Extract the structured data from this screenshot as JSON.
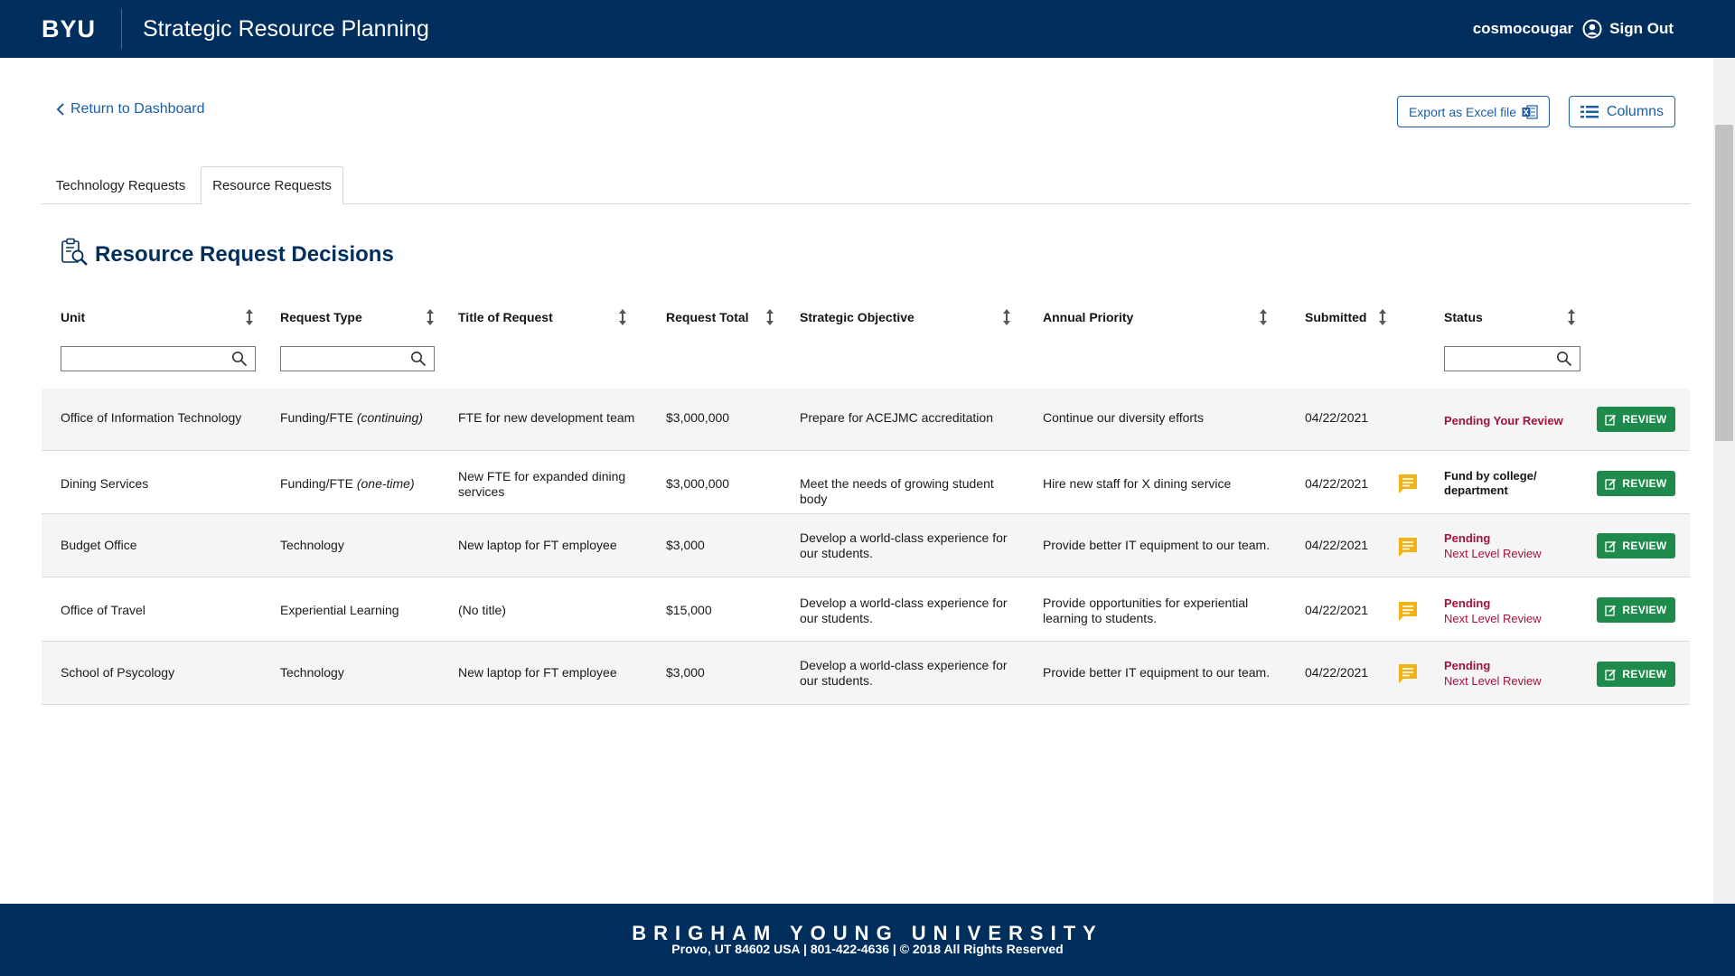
{
  "header": {
    "logo": "BYU",
    "title": "Strategic Resource Planning",
    "username": "cosmocougar",
    "sign_out": "Sign Out"
  },
  "nav": {
    "return_label": "Return to Dashboard"
  },
  "toolbar": {
    "export_label": "Export as Excel file",
    "columns_label": "Columns"
  },
  "tabs": [
    {
      "label": "Technology Requests",
      "active": false
    },
    {
      "label": "Resource Requests",
      "active": true
    }
  ],
  "section": {
    "title": "Resource Request Decisions"
  },
  "table": {
    "columns": [
      "Unit",
      "Request Type",
      "Title of Request",
      "Request Total",
      "Strategic Objective",
      "Annual Priority",
      "Submitted",
      "Status"
    ],
    "review_label": "REVIEW",
    "rows": [
      {
        "unit": "Office of Information Technology",
        "type": "Funding/FTE",
        "type_note": "(continuing)",
        "title": "FTE for new development team",
        "total": "$3,000,000",
        "objective": "Prepare for ACEJMC accreditation",
        "priority": "Continue our diversity efforts",
        "submitted": "04/22/2021",
        "has_comment": false,
        "status_main": "Pending Your Review",
        "status_sub": ""
      },
      {
        "unit": "Dining Services",
        "type": "Funding/FTE",
        "type_note": "(one-time)",
        "title": "New FTE for expanded dining services",
        "total": "$3,000,000",
        "objective": "Meet the needs of growing student body",
        "priority": "Hire new staff for X dining service",
        "submitted": "04/22/2021",
        "has_comment": true,
        "status_main": "Fund by college/ department",
        "status_sub": ""
      },
      {
        "unit": "Budget Office",
        "type": "Technology",
        "type_note": "",
        "title": "New laptop for FT employee",
        "total": "$3,000",
        "objective": "Develop a world-class experience for our students.",
        "priority": "Provide better IT equipment to our team.",
        "submitted": "04/22/2021",
        "has_comment": true,
        "status_main": "Pending",
        "status_sub": "Next Level Review"
      },
      {
        "unit": "Office of Travel",
        "type": "Experiential Learning",
        "type_note": "",
        "title": "(No title)",
        "total": "$15,000",
        "objective": "Develop a world-class experience for our students.",
        "priority": "Provide opportunities for experiential learning to students.",
        "submitted": "04/22/2021",
        "has_comment": true,
        "status_main": "Pending",
        "status_sub": "Next Level Review"
      },
      {
        "unit": "School of Psycology",
        "type": "Technology",
        "type_note": "",
        "title": "New laptop for FT employee",
        "total": "$3,000",
        "objective": "Develop a world-class experience for our students.",
        "priority": "Provide better IT equipment to our team.",
        "submitted": "04/22/2021",
        "has_comment": true,
        "status_main": "Pending",
        "status_sub": "Next Level Review"
      }
    ]
  },
  "footer": {
    "university": "BRIGHAM YOUNG UNIVERSITY",
    "address": "Provo, UT 84602 USA | 801-422-4636 | © 2018 All Rights Reserved"
  },
  "colors": {
    "brand_navy": "#002e5d",
    "link_blue": "#1c5da8",
    "review_green": "#1e8a4c",
    "pending_red": "#a3123a",
    "comment_yellow": "#f2b415"
  },
  "icons": {
    "user": "user-circle-icon",
    "back": "chevron-left-icon",
    "excel": "excel-file-icon",
    "columns": "columns-list-icon",
    "section": "clipboard-search-icon",
    "sort": "sort-arrows-icon",
    "search": "search-icon",
    "comment": "comment-icon",
    "review": "edit-icon"
  }
}
